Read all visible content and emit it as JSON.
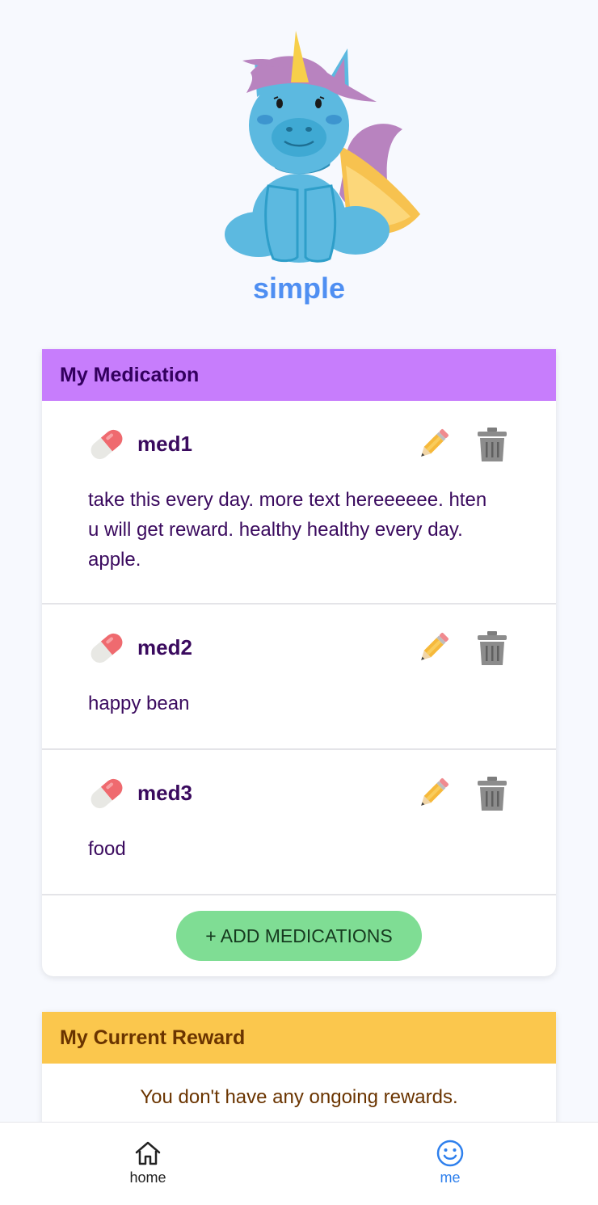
{
  "profile": {
    "username": "simple",
    "avatar_icon": "unicorn-icon"
  },
  "medication": {
    "title": "My Medication",
    "items": [
      {
        "name": "med1",
        "description": "take this every day. more text hereeeeee. hten u will get reward. healthy healthy every day. apple."
      },
      {
        "name": "med2",
        "description": "happy bean"
      },
      {
        "name": "med3",
        "description": "food"
      }
    ],
    "add_label": "+ ADD MEDICATIONS"
  },
  "reward": {
    "title": "My Current Reward",
    "empty_text": "You don't have any ongoing rewards."
  },
  "nav": {
    "home_label": "home",
    "me_label": "me",
    "active": "me"
  },
  "colors": {
    "username": "#4f8ff2",
    "medication_header": "#c77dfc",
    "reward_header": "#fbc74d",
    "add_button": "#7fdd94",
    "nav_active": "#2f80ed"
  }
}
